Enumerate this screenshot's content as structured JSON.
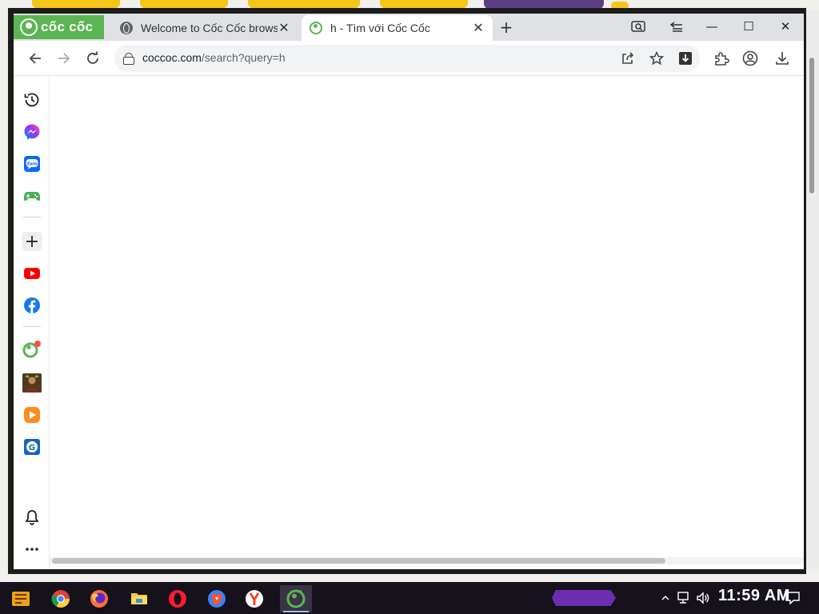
{
  "brand": {
    "name": "cốc cốc"
  },
  "tabs": [
    {
      "title": "Welcome to Cốc Cốc brows",
      "icon": "globe-icon",
      "active": false
    },
    {
      "title": "h - Tìm với Cốc Cốc",
      "icon": "coccoc-icon",
      "active": true
    }
  ],
  "tab_close_glyph": "✕",
  "new_tab_glyph": "+",
  "window_controls": {
    "search_tabs": "search-tabs-icon",
    "back_forward_cache": "tab-switch-icon",
    "minimize": "—",
    "maximize": "☐",
    "close": "✕"
  },
  "toolbar": {
    "url_host": "coccoc.com",
    "url_path": "/search?query=h"
  },
  "sidebar": {
    "items": [
      {
        "name": "history",
        "icon": "history-icon"
      },
      {
        "name": "messenger",
        "icon": "messenger-icon"
      },
      {
        "name": "zalo",
        "icon": "zalo-icon",
        "label": "Zalo"
      },
      {
        "name": "games",
        "icon": "gamepad-icon"
      },
      {
        "name": "add",
        "icon": "plus-icon"
      },
      {
        "name": "youtube",
        "icon": "youtube-icon"
      },
      {
        "name": "facebook",
        "icon": "facebook-icon"
      },
      {
        "name": "coccoc-app",
        "icon": "coccoc-icon"
      },
      {
        "name": "game-avatar",
        "icon": "game-thumbnail-icon"
      },
      {
        "name": "video",
        "icon": "play-icon"
      },
      {
        "name": "g-app",
        "icon": "g-app-icon",
        "label": "G"
      },
      {
        "name": "notifications",
        "icon": "bell-icon"
      },
      {
        "name": "more",
        "icon": "more-icon"
      }
    ]
  },
  "taskbar": {
    "apps": [
      "start-icon",
      "chrome-icon",
      "firefox-icon",
      "file-explorer-icon",
      "opera-icon",
      "brave-icon",
      "yandex-icon",
      "coccoc-icon"
    ],
    "clock": "11:59 AM",
    "colors": {
      "accent": "#6a2fb0"
    }
  },
  "colors": {
    "brand_green": "#5ab552"
  }
}
